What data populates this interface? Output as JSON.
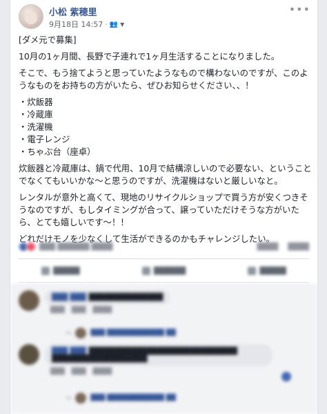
{
  "post": {
    "author": "小松 紫穂里",
    "date": "9月18日 14:57",
    "separator": "·",
    "audience_icon": "friends-icon",
    "more_icon": "•••"
  },
  "content": {
    "tag": "[ダメ元で募集]",
    "p1": "10月の1ヶ月間、長野で子連れで1ヶ月生活することになりました。",
    "p2": "そこで、もう捨てようと思っていたようなもので構わないのですが、このようなものをお持ちの方がいたら、ぜひお知らせください、、！",
    "items": [
      "・炊飯器",
      "・冷蔵庫",
      "・洗濯機",
      "・電子レンジ",
      "・ちゃぶ台（座卓）"
    ],
    "p3": "炊飯器と冷蔵庫は、鍋で代用、10月で結構涼しいので必要ない、ということでなくてもいいかな〜と思うのですが、洗濯機はないと厳しいなと。",
    "p4": "レンタルが意外と高くて、現地のリサイクルショップで買う方が安くつきそうなのですが、もしタイミングが合って、譲っていただけそうな方がいたら、とても嬉しいです〜！！",
    "p5": "どれだけモノを少なくして生活ができるのかもチャレンジしたい。"
  },
  "colors": {
    "name": "#365899",
    "text": "#1d2129",
    "meta": "#616770",
    "background": "#e9ebee"
  }
}
